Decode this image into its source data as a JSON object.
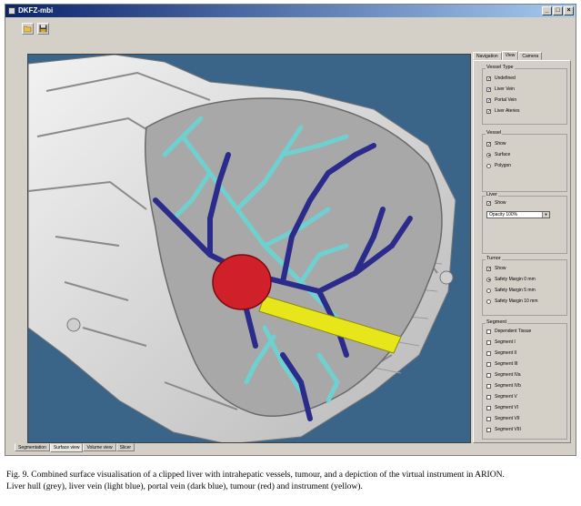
{
  "window": {
    "title": "DKFZ-mbi"
  },
  "toolbar": {
    "buttons": [
      {
        "icon": "open-folder-icon"
      },
      {
        "icon": "save-icon"
      }
    ]
  },
  "panel": {
    "tabs": [
      "Navigation",
      "View",
      "Camera"
    ],
    "active_tab": "View",
    "vessel_type": {
      "title": "Vessel Type",
      "items": [
        {
          "label": "Undefined",
          "checked": true
        },
        {
          "label": "Liver Vein",
          "checked": true
        },
        {
          "label": "Portal Vein",
          "checked": true
        },
        {
          "label": "Liver Ateries",
          "checked": true
        }
      ]
    },
    "vessel": {
      "title": "Vessel",
      "show_label": "Show",
      "show_checked": true,
      "options": [
        {
          "label": "Surface",
          "selected": true
        },
        {
          "label": "Polygon",
          "selected": false
        }
      ]
    },
    "liver": {
      "title": "Liver",
      "show_label": "Show",
      "show_checked": true,
      "opacity_value": "Opacity 100%"
    },
    "tumor": {
      "title": "Tumor",
      "show_label": "Show",
      "show_checked": true,
      "options": [
        {
          "label": "Safety Margin 0 mm",
          "selected": true
        },
        {
          "label": "Safety Margin 5 mm",
          "selected": false
        },
        {
          "label": "Safety Margin 10 mm",
          "selected": false
        }
      ]
    },
    "segment": {
      "title": "Segment",
      "items": [
        {
          "label": "Dependent Tissue",
          "checked": false
        },
        {
          "label": "Segment I",
          "checked": false
        },
        {
          "label": "Segment II",
          "checked": false
        },
        {
          "label": "Segment III",
          "checked": false
        },
        {
          "label": "Segment IVa",
          "checked": false
        },
        {
          "label": "Segment IVb",
          "checked": false
        },
        {
          "label": "Segment V",
          "checked": false
        },
        {
          "label": "Segment VI",
          "checked": false
        },
        {
          "label": "Segment VII",
          "checked": false
        },
        {
          "label": "Segment VIII",
          "checked": false
        }
      ]
    }
  },
  "bottom_tabs": [
    "Segmentation",
    "Surface view",
    "Volume view",
    "Slicer"
  ],
  "bottom_active_tab": "Surface view",
  "caption": {
    "line1": "Fig. 9. Combined surface visualisation of a clipped liver with intrahepatic vessels, tumour, and a depiction of the virtual instrument in ARION.",
    "line2": "Liver hull (grey), liver vein (light blue), portal vein (dark blue), tumour (red) and instrument (yellow)."
  },
  "colors": {
    "liver_hull": "#d9d9d9",
    "liver_vein": "#6fd0d0",
    "portal_vein": "#2b2b8c",
    "tumour": "#d0202a",
    "instrument": "#e6e61a",
    "background": "#3a6588"
  }
}
